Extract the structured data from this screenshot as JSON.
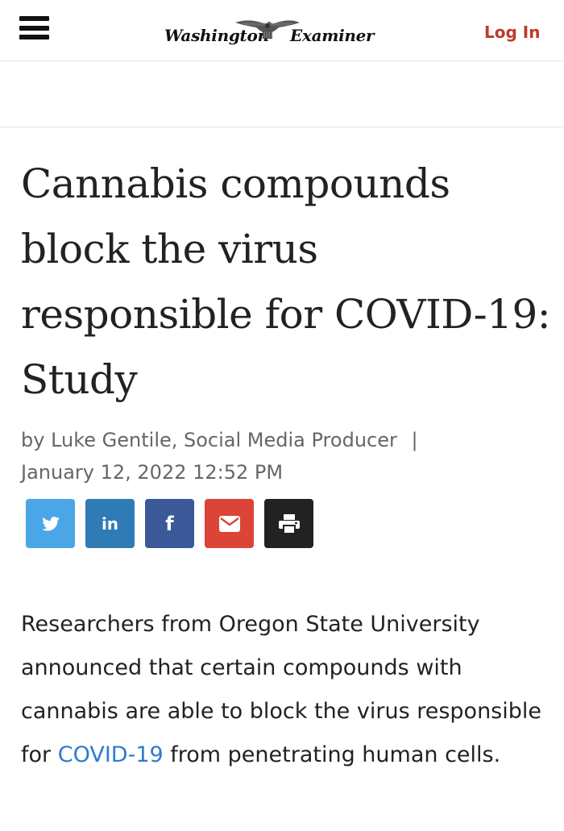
{
  "header": {
    "logo_left": "Washington",
    "logo_right": "Examiner",
    "login_label": "Log In"
  },
  "article": {
    "headline": "Cannabis compounds block the virus responsible for COVID-19: Study",
    "byline_author": "by Luke Gentile, Social Media Producer",
    "byline_separator": "|",
    "byline_date": "January 12, 2022 12:52 PM",
    "body_before": "Researchers from Oregon State University announced that certain compounds with cannabis are able to block the virus responsible for ",
    "body_link": "COVID-19",
    "body_after": " from penetrating human cells."
  },
  "share": {
    "buttons": [
      {
        "icon": "twitter-icon",
        "color": "#4aa6e6"
      },
      {
        "icon": "linkedin-icon",
        "label": "in",
        "color": "#2f7bb5"
      },
      {
        "icon": "facebook-icon",
        "label": "f",
        "color": "#3b5998"
      },
      {
        "icon": "email-icon",
        "color": "#db4437"
      },
      {
        "icon": "print-icon",
        "color": "#222222"
      }
    ]
  },
  "colors": {
    "accent": "#c0392b",
    "link": "#2b7bd0"
  }
}
